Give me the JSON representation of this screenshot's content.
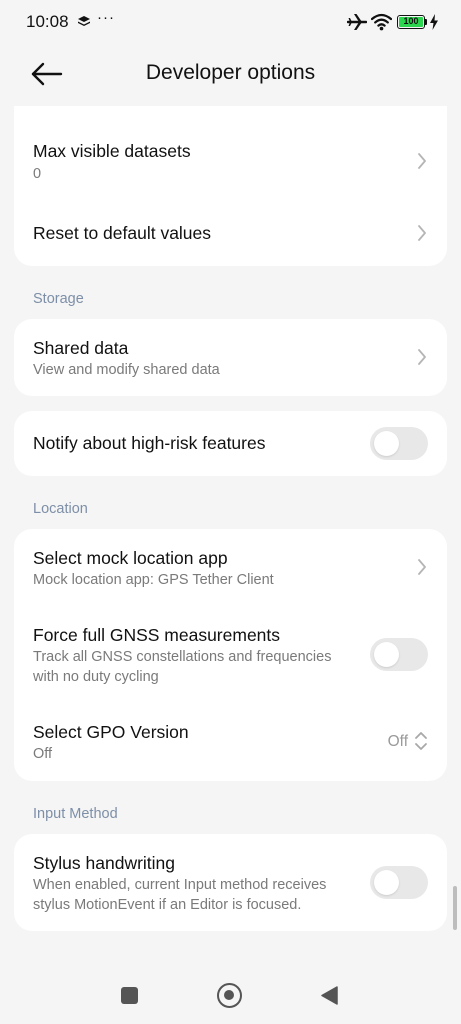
{
  "status_bar": {
    "time": "10:08",
    "dots": "···",
    "battery_level": "100",
    "battery_color": "#2cd64f"
  },
  "header": {
    "title": "Developer options",
    "back_icon": "arrow-left-icon"
  },
  "sections": {
    "top_card": {
      "max_visible": {
        "title": "Max visible datasets",
        "value": "0"
      },
      "reset": {
        "title": "Reset to default values"
      }
    },
    "storage": {
      "label": "Storage",
      "shared_data": {
        "title": "Shared data",
        "subtitle": "View and modify shared data"
      }
    },
    "notify": {
      "title": "Notify about high-risk features",
      "enabled": false
    },
    "location": {
      "label": "Location",
      "mock_app": {
        "title": "Select mock location app",
        "subtitle": "Mock location app: GPS Tether Client"
      },
      "gnss": {
        "title": "Force full GNSS measurements",
        "subtitle_line1": "Track all GNSS constellations and frequencies",
        "subtitle_line2": "with no duty cycling",
        "enabled": false
      },
      "gpo": {
        "title": "Select GPO Version",
        "subtitle": "Off",
        "value": "Off"
      }
    },
    "input_method": {
      "label": "Input Method",
      "stylus": {
        "title": "Stylus handwriting",
        "subtitle_line1": "When enabled, current Input method receives",
        "subtitle_line2": "stylus MotionEvent if an Editor is focused.",
        "enabled": false
      }
    }
  },
  "nav_bar": {
    "recents_icon": "square-icon",
    "home_icon": "circle-icon",
    "back_icon": "triangle-back-icon"
  }
}
